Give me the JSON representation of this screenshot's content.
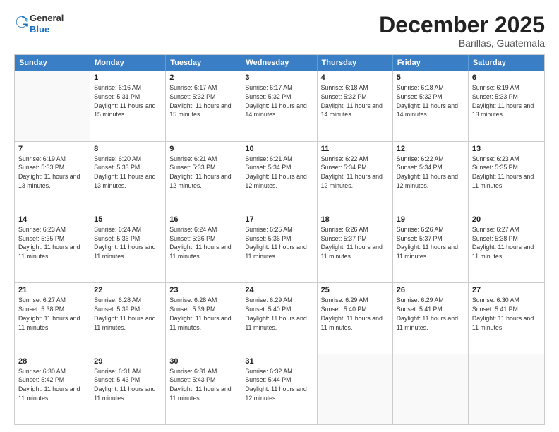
{
  "header": {
    "logo_general": "General",
    "logo_blue": "Blue",
    "month_title": "December 2025",
    "subtitle": "Barillas, Guatemala"
  },
  "days_of_week": [
    "Sunday",
    "Monday",
    "Tuesday",
    "Wednesday",
    "Thursday",
    "Friday",
    "Saturday"
  ],
  "weeks": [
    [
      {
        "day": "",
        "empty": true
      },
      {
        "day": "1",
        "sunrise": "6:16 AM",
        "sunset": "5:31 PM",
        "daylight": "11 hours and 15 minutes."
      },
      {
        "day": "2",
        "sunrise": "6:17 AM",
        "sunset": "5:32 PM",
        "daylight": "11 hours and 15 minutes."
      },
      {
        "day": "3",
        "sunrise": "6:17 AM",
        "sunset": "5:32 PM",
        "daylight": "11 hours and 14 minutes."
      },
      {
        "day": "4",
        "sunrise": "6:18 AM",
        "sunset": "5:32 PM",
        "daylight": "11 hours and 14 minutes."
      },
      {
        "day": "5",
        "sunrise": "6:18 AM",
        "sunset": "5:32 PM",
        "daylight": "11 hours and 14 minutes."
      },
      {
        "day": "6",
        "sunrise": "6:19 AM",
        "sunset": "5:33 PM",
        "daylight": "11 hours and 13 minutes."
      }
    ],
    [
      {
        "day": "7",
        "sunrise": "6:19 AM",
        "sunset": "5:33 PM",
        "daylight": "11 hours and 13 minutes."
      },
      {
        "day": "8",
        "sunrise": "6:20 AM",
        "sunset": "5:33 PM",
        "daylight": "11 hours and 13 minutes."
      },
      {
        "day": "9",
        "sunrise": "6:21 AM",
        "sunset": "5:33 PM",
        "daylight": "11 hours and 12 minutes."
      },
      {
        "day": "10",
        "sunrise": "6:21 AM",
        "sunset": "5:34 PM",
        "daylight": "11 hours and 12 minutes."
      },
      {
        "day": "11",
        "sunrise": "6:22 AM",
        "sunset": "5:34 PM",
        "daylight": "11 hours and 12 minutes."
      },
      {
        "day": "12",
        "sunrise": "6:22 AM",
        "sunset": "5:34 PM",
        "daylight": "11 hours and 12 minutes."
      },
      {
        "day": "13",
        "sunrise": "6:23 AM",
        "sunset": "5:35 PM",
        "daylight": "11 hours and 11 minutes."
      }
    ],
    [
      {
        "day": "14",
        "sunrise": "6:23 AM",
        "sunset": "5:35 PM",
        "daylight": "11 hours and 11 minutes."
      },
      {
        "day": "15",
        "sunrise": "6:24 AM",
        "sunset": "5:36 PM",
        "daylight": "11 hours and 11 minutes."
      },
      {
        "day": "16",
        "sunrise": "6:24 AM",
        "sunset": "5:36 PM",
        "daylight": "11 hours and 11 minutes."
      },
      {
        "day": "17",
        "sunrise": "6:25 AM",
        "sunset": "5:36 PM",
        "daylight": "11 hours and 11 minutes."
      },
      {
        "day": "18",
        "sunrise": "6:26 AM",
        "sunset": "5:37 PM",
        "daylight": "11 hours and 11 minutes."
      },
      {
        "day": "19",
        "sunrise": "6:26 AM",
        "sunset": "5:37 PM",
        "daylight": "11 hours and 11 minutes."
      },
      {
        "day": "20",
        "sunrise": "6:27 AM",
        "sunset": "5:38 PM",
        "daylight": "11 hours and 11 minutes."
      }
    ],
    [
      {
        "day": "21",
        "sunrise": "6:27 AM",
        "sunset": "5:38 PM",
        "daylight": "11 hours and 11 minutes."
      },
      {
        "day": "22",
        "sunrise": "6:28 AM",
        "sunset": "5:39 PM",
        "daylight": "11 hours and 11 minutes."
      },
      {
        "day": "23",
        "sunrise": "6:28 AM",
        "sunset": "5:39 PM",
        "daylight": "11 hours and 11 minutes."
      },
      {
        "day": "24",
        "sunrise": "6:29 AM",
        "sunset": "5:40 PM",
        "daylight": "11 hours and 11 minutes."
      },
      {
        "day": "25",
        "sunrise": "6:29 AM",
        "sunset": "5:40 PM",
        "daylight": "11 hours and 11 minutes."
      },
      {
        "day": "26",
        "sunrise": "6:29 AM",
        "sunset": "5:41 PM",
        "daylight": "11 hours and 11 minutes."
      },
      {
        "day": "27",
        "sunrise": "6:30 AM",
        "sunset": "5:41 PM",
        "daylight": "11 hours and 11 minutes."
      }
    ],
    [
      {
        "day": "28",
        "sunrise": "6:30 AM",
        "sunset": "5:42 PM",
        "daylight": "11 hours and 11 minutes."
      },
      {
        "day": "29",
        "sunrise": "6:31 AM",
        "sunset": "5:43 PM",
        "daylight": "11 hours and 11 minutes."
      },
      {
        "day": "30",
        "sunrise": "6:31 AM",
        "sunset": "5:43 PM",
        "daylight": "11 hours and 11 minutes."
      },
      {
        "day": "31",
        "sunrise": "6:32 AM",
        "sunset": "5:44 PM",
        "daylight": "11 hours and 12 minutes."
      },
      {
        "day": "",
        "empty": true
      },
      {
        "day": "",
        "empty": true
      },
      {
        "day": "",
        "empty": true
      }
    ]
  ]
}
